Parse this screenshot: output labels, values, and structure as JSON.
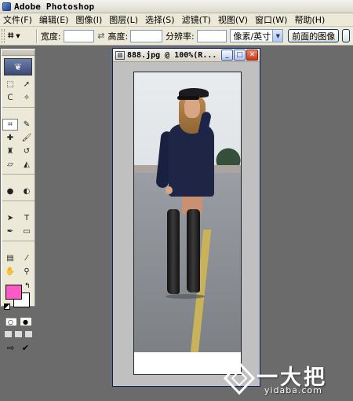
{
  "app": {
    "title": "Adobe Photoshop"
  },
  "menu": [
    "文件(F)",
    "编辑(E)",
    "图像(I)",
    "图层(L)",
    "选择(S)",
    "滤镜(T)",
    "视图(V)",
    "窗口(W)",
    "帮助(H)"
  ],
  "options": {
    "width_label": "宽度:",
    "width_value": "",
    "height_label": "高度:",
    "height_value": "",
    "resolution_label": "分辨率:",
    "resolution_value": "",
    "unit_select": "像素/英寸",
    "front_image_button": "前面的图像"
  },
  "toolbox": {
    "foreground_color": "#ff59c7",
    "background_color": "#ffffff",
    "tools": [
      {
        "name": "rectangular-marquee-icon",
        "glyph": "⬚"
      },
      {
        "name": "move-icon",
        "glyph": "➚"
      },
      {
        "name": "lasso-icon",
        "glyph": "ᑕ"
      },
      {
        "name": "magic-wand-icon",
        "glyph": "✧"
      },
      {
        "name": "crop-icon",
        "glyph": "⌗",
        "active": true
      },
      {
        "name": "slice-icon",
        "glyph": "✎"
      },
      {
        "name": "healing-brush-icon",
        "glyph": "✚"
      },
      {
        "name": "brush-icon",
        "glyph": "🖌"
      },
      {
        "name": "clone-stamp-icon",
        "glyph": "♜"
      },
      {
        "name": "history-brush-icon",
        "glyph": "↺"
      },
      {
        "name": "eraser-icon",
        "glyph": "▱"
      },
      {
        "name": "paint-bucket-icon",
        "glyph": "◭"
      },
      {
        "name": "blur-icon",
        "glyph": "●"
      },
      {
        "name": "dodge-icon",
        "glyph": "◐"
      },
      {
        "name": "path-selection-icon",
        "glyph": "➤"
      },
      {
        "name": "type-icon",
        "glyph": "T"
      },
      {
        "name": "pen-icon",
        "glyph": "✒"
      },
      {
        "name": "shape-icon",
        "glyph": "▭"
      },
      {
        "name": "notes-icon",
        "glyph": "▤"
      },
      {
        "name": "eyedropper-icon",
        "glyph": "⁄"
      },
      {
        "name": "hand-icon",
        "glyph": "✋"
      },
      {
        "name": "zoom-icon",
        "glyph": "⚲"
      }
    ]
  },
  "document": {
    "title": "888.jpg @ 100%(R..."
  },
  "watermark": {
    "text": "一大把",
    "url": "yidaba.com"
  }
}
